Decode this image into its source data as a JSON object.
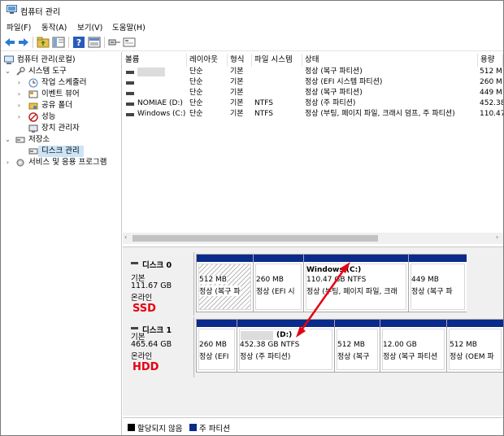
{
  "window": {
    "title": "컴퓨터 관리"
  },
  "menu": [
    "파일(F)",
    "동작(A)",
    "보기(V)",
    "도움말(H)"
  ],
  "tree": {
    "root": "컴퓨터 관리(로컬)",
    "system_tools": "시스템 도구",
    "task_scheduler": "작업 스케줄러",
    "event_viewer": "이벤트 뷰어",
    "shared_folders": "공유 폴더",
    "performance": "성능",
    "device_manager": "장치 관리자",
    "storage": "저장소",
    "disk_management": "디스크 관리",
    "services": "서비스 및 응용 프로그램"
  },
  "columns": [
    "볼륨",
    "레이아웃",
    "형식",
    "파일 시스템",
    "상태",
    "용량"
  ],
  "volumes": [
    {
      "name": "",
      "layout": "단순",
      "type": "기본",
      "fs": "",
      "status": "정상 (복구 파티션)",
      "capacity": "512 M"
    },
    {
      "name": "",
      "layout": "단순",
      "type": "기본",
      "fs": "",
      "status": "정상 (EFI 시스템 파티션)",
      "capacity": "260 M"
    },
    {
      "name": "",
      "layout": "단순",
      "type": "기본",
      "fs": "",
      "status": "정상 (복구 파티션)",
      "capacity": "449 M"
    },
    {
      "name": "NOMIAE (D:)",
      "layout": "단순",
      "type": "기본",
      "fs": "NTFS",
      "status": "정상 (주 파티션)",
      "capacity": "452.38"
    },
    {
      "name": "Windows (C:)",
      "layout": "단순",
      "type": "기본",
      "fs": "NTFS",
      "status": "정상 (부팅, 페이지 파일, 크래시 덤프, 주 파티션)",
      "capacity": "110.47"
    }
  ],
  "disks": [
    {
      "name": "디스크 0",
      "kind": "기본",
      "size": "111.67 GB",
      "state": "온라인",
      "tag": "SSD",
      "partitions": [
        {
          "title": "",
          "size": "512 MB",
          "status": "정상 (복구 파"
        },
        {
          "title": "",
          "size": "260 MB",
          "status": "정상 (EFI 시"
        },
        {
          "title": "Windows (C:)",
          "size": "110.47 GB NTFS",
          "status": "정상 (부팅, 페이지 파일, 크래"
        },
        {
          "title": "",
          "size": "449 MB",
          "status": "정상 (복구 파"
        }
      ]
    },
    {
      "name": "디스크 1",
      "kind": "기본",
      "size": "465.64 GB",
      "state": "온라인",
      "tag": "HDD",
      "partitions": [
        {
          "title": "",
          "size": "260 MB",
          "status": "정상 (EFI"
        },
        {
          "title": "(D:)",
          "size": "452.38 GB NTFS",
          "status": "정상 (주 파티션)"
        },
        {
          "title": "",
          "size": "512 MB",
          "status": "정상 (복구"
        },
        {
          "title": "",
          "size": "12.00 GB",
          "status": "정상 (복구 파티션"
        },
        {
          "title": "",
          "size": "512 MB",
          "status": "정상 (OEM 파"
        }
      ]
    }
  ],
  "legend": {
    "unallocated": "할당되지 않음",
    "primary": "주 파티션"
  },
  "colors": {
    "partition_bar": "#0a2a8c",
    "tag": "#e60012",
    "arrow": "#e60012",
    "selection": "#cce4f7"
  }
}
